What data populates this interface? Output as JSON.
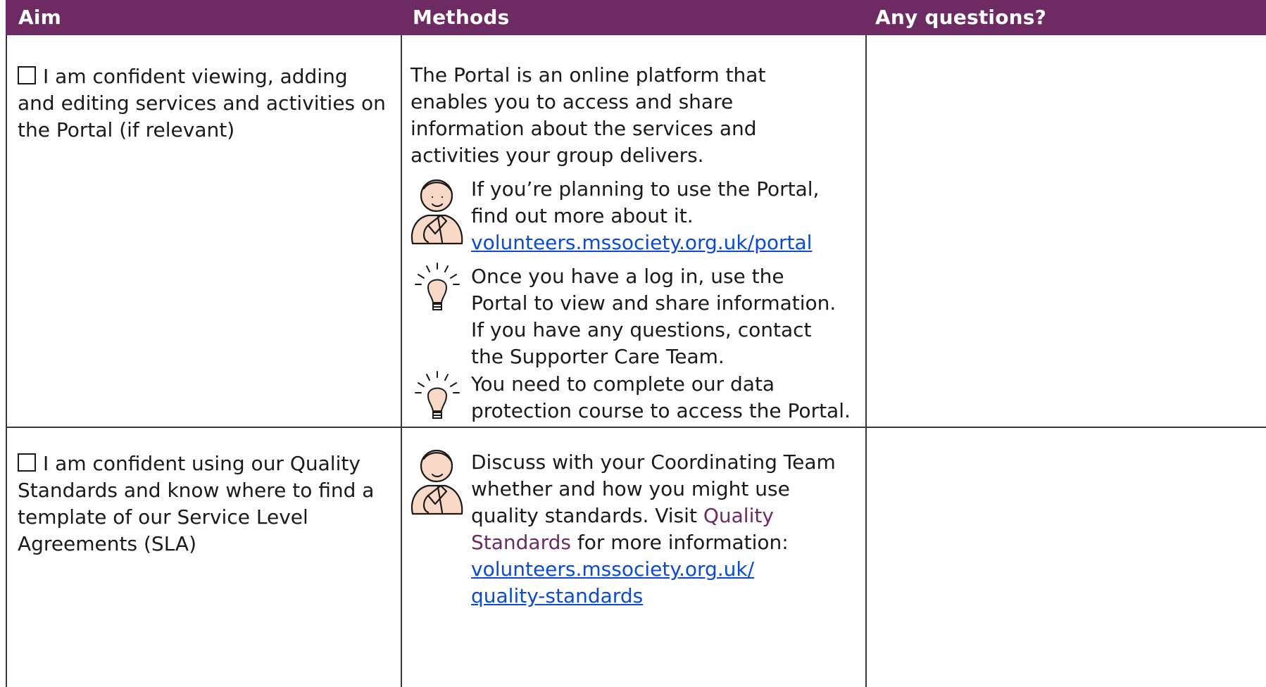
{
  "header": {
    "aim": "Aim",
    "methods": "Methods",
    "questions": "Any questions?"
  },
  "rows": [
    {
      "aim": {
        "checkbox": "☐",
        "line1": "I am confident viewing, adding",
        "line2": "and editing services and activities on",
        "line3": "the Portal (if relevant)"
      },
      "intro": {
        "line1": "The Portal is an online platform that",
        "line2": "enables you to access and share",
        "line3": "information about the services and",
        "line4": "activities your group delivers."
      },
      "tip1": {
        "icon": "thinking-person-icon",
        "line1": "If you’re planning to use the Portal,",
        "line2": "find out more about it.",
        "link": "volunteers.mssociety.org.uk/portal"
      },
      "tip2": {
        "icon": "lightbulb-icon",
        "line1": "Once you have a log in, use the",
        "line2": "Portal to view and share information.",
        "line3": "If you have any questions, contact",
        "line4": "the Supporter Care Team."
      },
      "tip3": {
        "icon": "lightbulb-icon",
        "line1": "You need to complete our data",
        "line2": "protection course to access the Portal."
      }
    },
    {
      "aim": {
        "checkbox": "☐",
        "line1": "I am confident using our Quality",
        "line2": "Standards and know where to find a",
        "line3": "template of our Service Level",
        "line4": "Agreements (SLA)"
      },
      "tip1": {
        "icon": "thinking-person-icon",
        "line1": "Discuss with your Coordinating Team",
        "line2": "whether and how you might use",
        "line3_pre": "quality standards. Visit ",
        "line3_link": "Quality",
        "line4_link": "Standards",
        "line4_post": " for more information:",
        "url_line1": "volunteers.mssociety.org.uk/",
        "url_line2": "quality-standards"
      }
    }
  ],
  "colors": {
    "header_bg": "#6e2a62",
    "icon_fill": "#f8d9c8",
    "link": "#0b4ad6"
  }
}
